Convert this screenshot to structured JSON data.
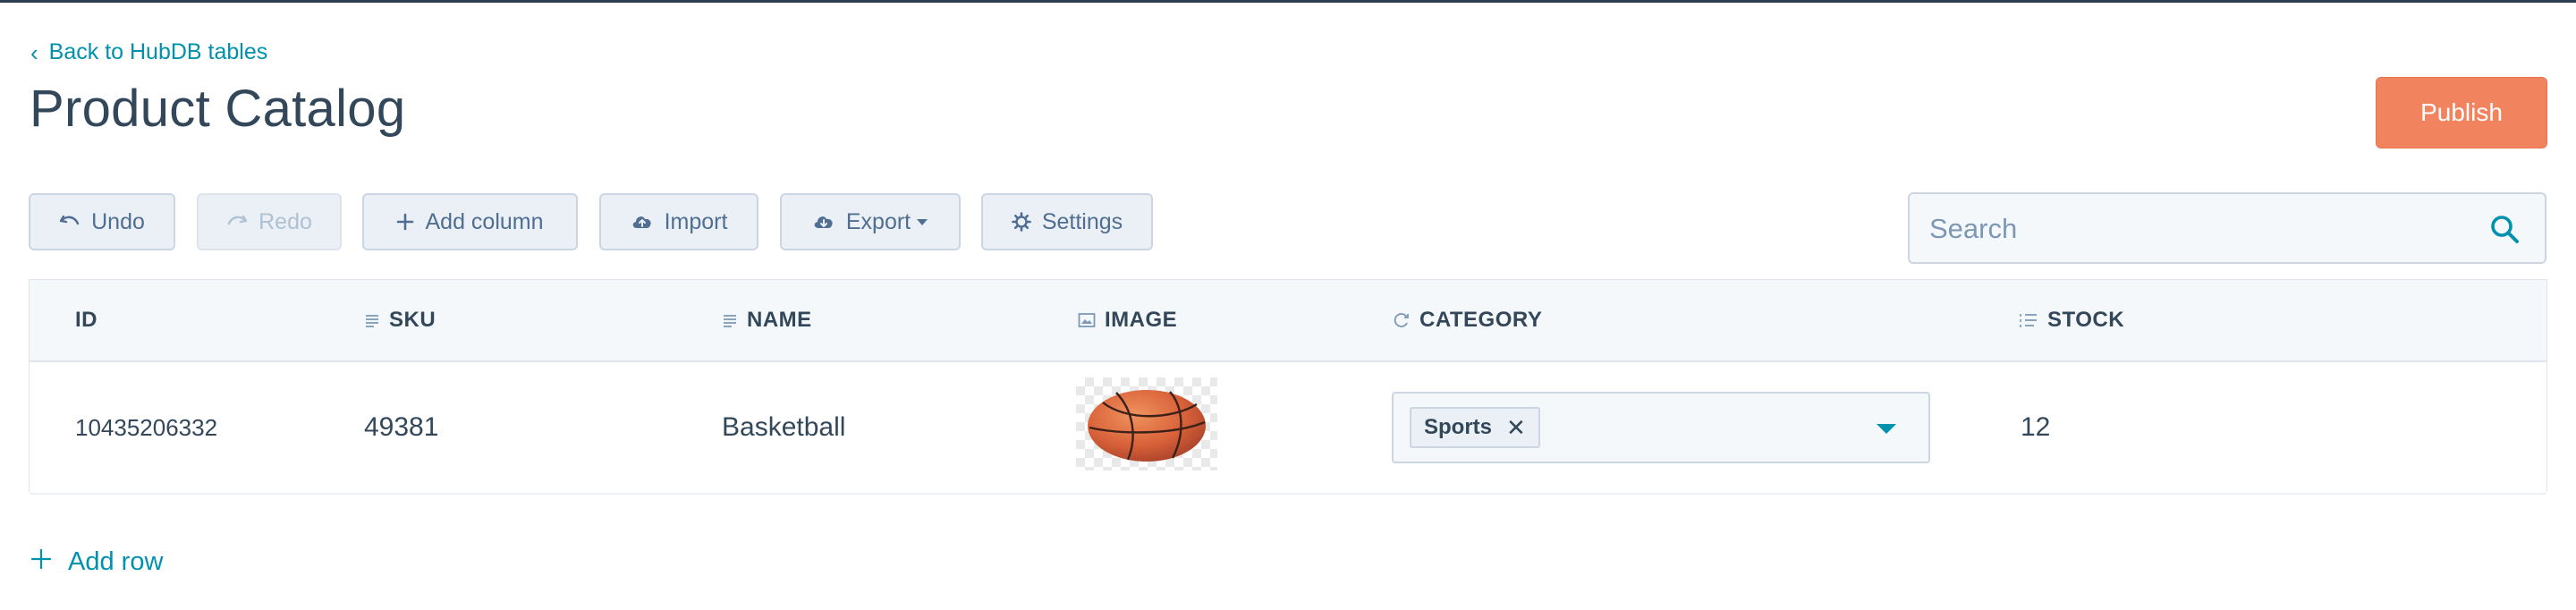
{
  "nav": {
    "back_label": "Back to HubDB tables"
  },
  "page": {
    "title": "Product Catalog",
    "publish_label": "Publish"
  },
  "toolbar": {
    "undo": "Undo",
    "redo": "Redo",
    "add_column": "Add column",
    "import": "Import",
    "export": "Export",
    "settings": "Settings"
  },
  "search": {
    "placeholder": "Search",
    "value": ""
  },
  "table": {
    "columns": [
      {
        "label": "ID",
        "icon": "none"
      },
      {
        "label": "SKU",
        "icon": "text-lines-icon"
      },
      {
        "label": "NAME",
        "icon": "text-lines-icon"
      },
      {
        "label": "IMAGE",
        "icon": "image-icon"
      },
      {
        "label": "CATEGORY",
        "icon": "select-icon"
      },
      {
        "label": "STOCK",
        "icon": "number-list-icon"
      }
    ],
    "rows": [
      {
        "id": "10435206332",
        "sku": "49381",
        "name": "Basketball",
        "image": "basketball",
        "category": [
          "Sports"
        ],
        "stock": "12"
      }
    ]
  },
  "footer": {
    "add_row": "Add row"
  },
  "colors": {
    "accent": "#0091ae",
    "publish": "#f2835f",
    "text": "#33475b",
    "header_bg": "#f5f8fa",
    "button_bg": "#eaf0f6"
  }
}
